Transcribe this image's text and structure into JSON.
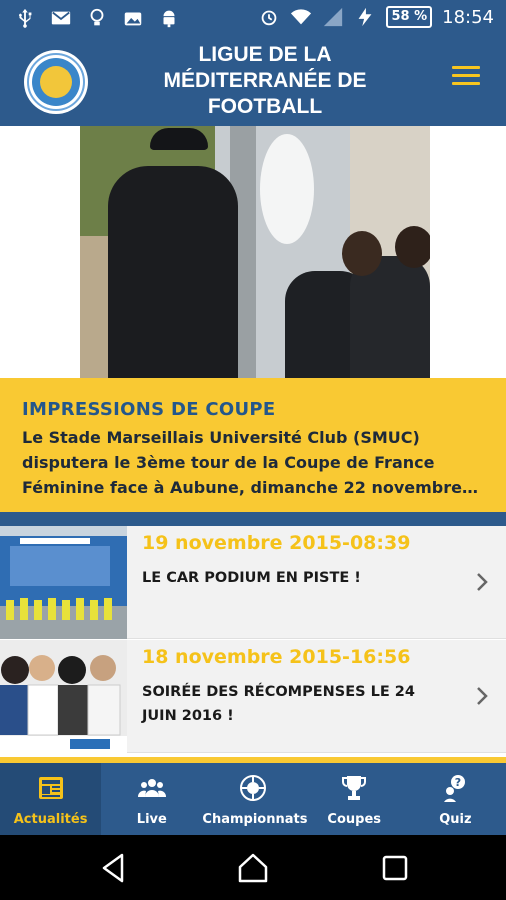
{
  "status_bar": {
    "battery": "58 %",
    "time": "18:54",
    "icons": [
      "usb-icon",
      "mail-icon",
      "lightbulb-icon",
      "photo-icon",
      "android-icon",
      "alarm-icon",
      "wifi-icon",
      "signal-icon",
      "charging-icon",
      "battery-icon"
    ]
  },
  "header": {
    "title_lines": [
      "LIGUE DE LA",
      "MÉDITERRANÉE DE",
      "FOOTBALL"
    ],
    "menu_icon": "hamburger-menu-icon",
    "logo": "league-logo"
  },
  "featured": {
    "title": "IMPRESSIONS DE COUPE",
    "text": "Le Stade Marseillais Université Club (SMUC) disputera le 3ème tour de la Coupe de France Féminine face à Aubune, dimanche 22 novembre…"
  },
  "news": [
    {
      "date": "19 novembre 2015-08:39",
      "title": "LE CAR PODIUM EN PISTE !"
    },
    {
      "date": "18 novembre 2015-16:56",
      "title": "SOIRÉE DES RÉCOMPENSES LE 24 JUIN 2016 !"
    }
  ],
  "nav": {
    "tabs": [
      {
        "label": "Actualités",
        "icon": "newspaper-icon",
        "active": true
      },
      {
        "label": "Live",
        "icon": "group-icon",
        "active": false
      },
      {
        "label": "Championnats",
        "icon": "trophy-ball-icon",
        "active": false
      },
      {
        "label": "Coupes",
        "icon": "cup-icon",
        "active": false
      },
      {
        "label": "Quiz",
        "icon": "quiz-icon",
        "active": false
      }
    ]
  },
  "colors": {
    "primary": "#2d5a8c",
    "accent": "#f9c933",
    "date": "#f5c21a"
  }
}
